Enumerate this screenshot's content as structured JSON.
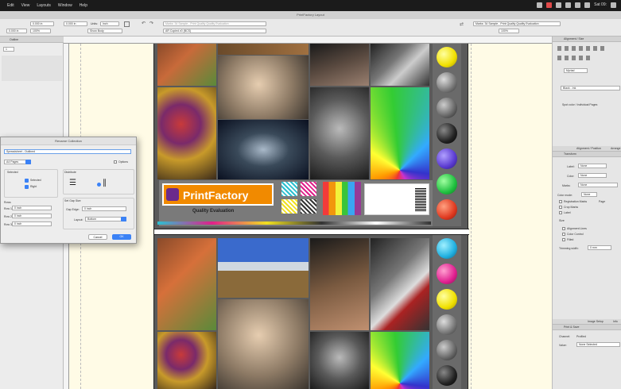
{
  "menubar": {
    "items": [
      "Edit",
      "View",
      "Layouts",
      "Window",
      "Help"
    ],
    "clock": "Sat 09:"
  },
  "document": {
    "title": "PrintFactory Layout"
  },
  "toolbar": {
    "units_label": "Units:",
    "units_value": "Inch",
    "zoom_value": "100%",
    "fit_value": "Show Body",
    "profile_value": "AR Copied v0 (BCS)",
    "marks_value": "Marks: 34 Sample - Print Quality Quality Evaluation",
    "field_a": "0.000 in",
    "field_b": "0.000 in",
    "field_c": "0.000 in"
  },
  "left_panel": {
    "header": "Outline",
    "field_value": "1",
    "dropdown_value": ""
  },
  "dialog": {
    "title": "Rename Collection",
    "name_value": "Spreadsheet - Outlined",
    "preset_value": "A4 Pages",
    "options_label": "Options",
    "select_label": "Selected",
    "check1": "Selected",
    "check2": "Right",
    "rows_label": "Rows",
    "rows": [
      {
        "label": "Row 1",
        "value": "0 inch"
      },
      {
        "label": "Row 2",
        "value": "0 inch"
      },
      {
        "label": "Row 3",
        "value": "0 inch"
      }
    ],
    "distribute_label": "Distribute",
    "spacing_label": "Set Gap Size",
    "gap_label": "Gap Edge:",
    "gap_value": "0 inch",
    "layout_label": "Layout:",
    "layout_value": "Bottom",
    "cancel_label": "Cancel",
    "ok_label": "OK"
  },
  "print_sheet": {
    "brand": "PrintFactory",
    "subtitle": "Quality Evaluation"
  },
  "right_panel": {
    "header1": "Alignment / Size",
    "font_value": "Myriad",
    "style_value": "Black - Ink",
    "section_label": "Spot color / Individual Pages",
    "tabs": [
      "Alignment / Position",
      "Arrange"
    ],
    "header2": "Transform",
    "rows": [
      {
        "label": "Label:",
        "value": "None"
      },
      {
        "label": "Color:",
        "value": "None"
      },
      {
        "label": "Marks:",
        "value": "None"
      }
    ],
    "color_mode_label": "Color mode:",
    "color_mode_value": "None",
    "checks": [
      "Registration Marks",
      "Page",
      "Crop Marks",
      "Label"
    ],
    "size_label": "Size",
    "options": [
      "Alignment Lines",
      "Color Control",
      "Filled"
    ],
    "trimming_label": "Trimming width:",
    "trimming_value": "0 mm",
    "bottom_tabs": [
      "Image Setup",
      "Info"
    ],
    "header3": "Print & Save",
    "channel_label": "Channel:",
    "channel_value": "Profiled",
    "value_label": "Value:",
    "value_value": "None Selected"
  },
  "colors": {
    "accent_blue": "#3b82f6",
    "brand_orange": "#f18a00",
    "brand_purple": "#6b2a8c"
  }
}
